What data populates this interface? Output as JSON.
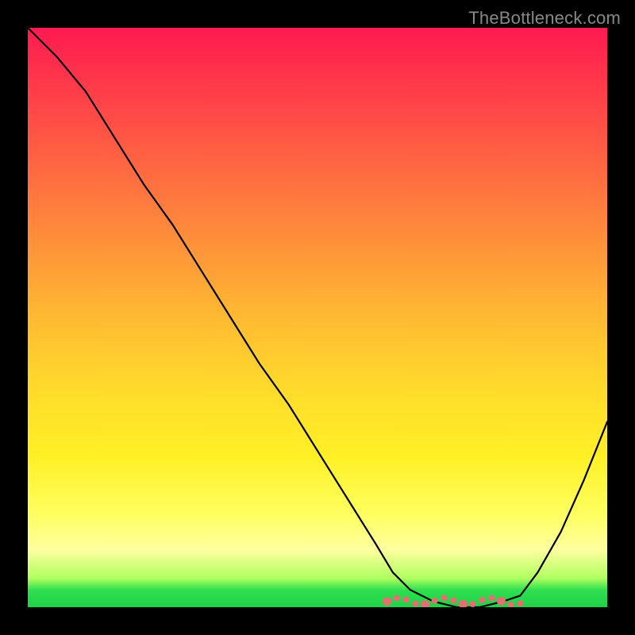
{
  "watermark": "TheBottleneck.com",
  "chart_data": {
    "type": "line",
    "title": "",
    "xlabel": "",
    "ylabel": "",
    "xlim": [
      0,
      100
    ],
    "ylim": [
      0,
      100
    ],
    "series": [
      {
        "name": "curve",
        "x": [
          0,
          5,
          10,
          15,
          20,
          25,
          30,
          35,
          40,
          45,
          50,
          55,
          60,
          63,
          66,
          70,
          74,
          78,
          82,
          85,
          88,
          92,
          96,
          100
        ],
        "y": [
          100,
          95,
          89,
          81,
          73,
          66,
          58,
          50,
          42,
          35,
          27,
          19,
          11,
          6,
          3,
          1,
          0,
          0,
          1,
          2,
          6,
          13,
          22,
          32
        ],
        "color": "#000000"
      }
    ],
    "dots": {
      "x_range": [
        62,
        85
      ],
      "y": 1,
      "color": "#e27070",
      "count_approx": 15
    },
    "background_gradient": {
      "top": "#ff1a50",
      "middle": "#ffda2c",
      "bottom": "#20d048"
    }
  }
}
